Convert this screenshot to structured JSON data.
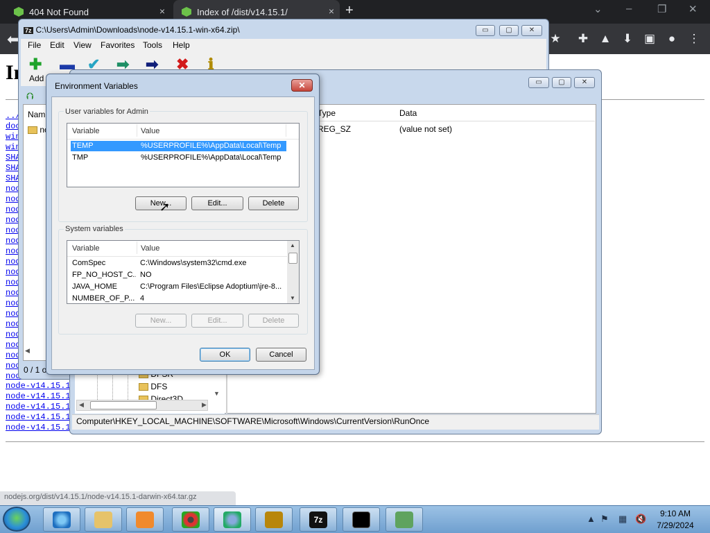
{
  "browser": {
    "tabs": [
      {
        "label": "404 Not Found",
        "close": "×"
      },
      {
        "label": "Index of /dist/v14.15.1/",
        "close": "×"
      }
    ],
    "new_tab": "+",
    "window_controls": [
      "⌄",
      "–",
      "❐",
      "✕"
    ],
    "toolbar_icons": [
      "★",
      "✚",
      "▲",
      "⬇",
      "▣",
      "●",
      "⋮"
    ]
  },
  "page": {
    "heading": "In",
    "links": [
      "../",
      "doc",
      "win",
      "win",
      "SHA",
      "SHA",
      "SHA",
      "node",
      "node",
      "node",
      "node",
      "node",
      "node",
      "node",
      "node",
      "node",
      "node",
      "node",
      "node",
      "node",
      "node",
      "node",
      "node",
      "node",
      "node",
      "node",
      "node-v14.15.1",
      "node-v14.15.1",
      "node-v14.15.1",
      "node-v14.15.1",
      "node-v14.15.1"
    ],
    "status_url": "nodejs.org/dist/v14.15.1/node-v14.15.1-darwin-x64.tar.gz"
  },
  "zip": {
    "title": "C:\\Users\\Admin\\Downloads\\node-v14.15.1-win-x64.zip\\",
    "menu": [
      "File",
      "Edit",
      "View",
      "Favorites",
      "Tools",
      "Help"
    ],
    "add_label": "Add",
    "col_name": "Nam",
    "folder_name": "no",
    "status": "0 / 1 o",
    "controls": [
      "▭",
      "▢",
      "✕"
    ]
  },
  "registry": {
    "col_type": "Type",
    "col_data": "Data",
    "row_type": "REG_SZ",
    "row_data": "(value not set)",
    "tree": [
      "DFSR",
      "DFS",
      "Direct3D"
    ],
    "path": "Computer\\HKEY_LOCAL_MACHINE\\SOFTWARE\\Microsoft\\Windows\\CurrentVersion\\RunOnce",
    "controls": [
      "▭",
      "▢",
      "✕"
    ]
  },
  "env": {
    "title": "Environment Variables",
    "close": "✕",
    "user_group_label": "User variables for Admin",
    "system_group_label": "System variables",
    "col_variable": "Variable",
    "col_value": "Value",
    "user_vars": [
      {
        "name": "TEMP",
        "value": "%USERPROFILE%\\AppData\\Local\\Temp"
      },
      {
        "name": "TMP",
        "value": "%USERPROFILE%\\AppData\\Local\\Temp"
      }
    ],
    "system_vars": [
      {
        "name": "ComSpec",
        "value": "C:\\Windows\\system32\\cmd.exe"
      },
      {
        "name": "FP_NO_HOST_C...",
        "value": "NO"
      },
      {
        "name": "JAVA_HOME",
        "value": "C:\\Program Files\\Eclipse Adoptium\\jre-8..."
      },
      {
        "name": "NUMBER_OF_P...",
        "value": "4"
      }
    ],
    "buttons": {
      "new": "New...",
      "edit": "Edit...",
      "delete": "Delete",
      "ok": "OK",
      "cancel": "Cancel"
    }
  },
  "taskbar": {
    "time": "9:10 AM",
    "date": "7/29/2024",
    "apps": [
      "Internet Explorer",
      "Windows Explorer",
      "Media Player",
      "Chrome",
      "Browser",
      "DOSBox",
      "7-Zip",
      "Command Prompt",
      "Network"
    ],
    "tray_icons": [
      "▲",
      "⚑",
      "▦",
      "🔇"
    ]
  },
  "colors": {
    "accent": "#3399ff",
    "link": "#0000ee",
    "taskbar": "#6f9fcf"
  }
}
